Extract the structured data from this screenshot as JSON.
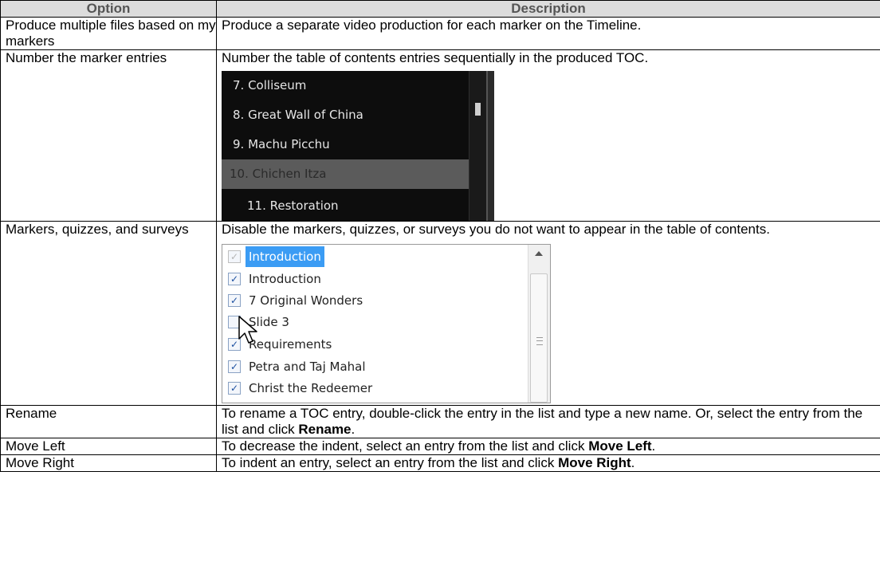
{
  "table": {
    "headers": [
      "Option",
      "Description"
    ],
    "rows": [
      {
        "option": "Produce multiple files based on my markers",
        "description": "Produce a separate video production for each marker on the Timeline."
      },
      {
        "option": "Number the marker entries",
        "description": "Number the table of contents entries sequentially in the produced TOC."
      },
      {
        "option": "Markers, quizzes, and surveys",
        "description": "Disable the markers, quizzes, or surveys you do not want to appear in the table of contents."
      },
      {
        "option": "Rename",
        "description_pre": "To rename a TOC entry, double-click the entry in the list and type a new name. Or, select the entry from the list and click ",
        "description_bold": "Rename",
        "description_post": "."
      },
      {
        "option": "Move Left",
        "description_pre": "To decrease the indent, select an entry from the list and click ",
        "description_bold": "Move Left",
        "description_post": "."
      },
      {
        "option": "Move Right",
        "description_pre": "To indent an entry, select an entry from the list and click ",
        "description_bold": "Move Right",
        "description_post": "."
      }
    ]
  },
  "toc_preview": {
    "entries": [
      {
        "label": "7. Colliseum",
        "state": "normal"
      },
      {
        "label": "8. Great Wall of China",
        "state": "normal"
      },
      {
        "label": "9. Machu Picchu",
        "state": "normal"
      },
      {
        "label": "10. Chichen Itza",
        "state": "selected"
      },
      {
        "label": "11. Restoration",
        "state": "sub"
      }
    ]
  },
  "checklist_preview": {
    "items": [
      {
        "label": "Introduction",
        "checked": true,
        "dim": true,
        "selected": true
      },
      {
        "label": "Introduction",
        "checked": true,
        "dim": false,
        "selected": false
      },
      {
        "label": "7 Original Wonders",
        "checked": true,
        "dim": false,
        "selected": false
      },
      {
        "label": "Slide 3",
        "checked": false,
        "dim": false,
        "selected": false
      },
      {
        "label": "Requirements",
        "checked": true,
        "dim": false,
        "selected": false
      },
      {
        "label": "Petra and Taj Mahal",
        "checked": true,
        "dim": false,
        "selected": false
      },
      {
        "label": "Christ the Redeemer",
        "checked": true,
        "dim": false,
        "selected": false
      }
    ]
  },
  "colors": {
    "header_bg": "#dcdcdc",
    "header_text": "#555555",
    "selection_blue": "#3b9cf4",
    "toc_bg": "#0d0d0d"
  }
}
